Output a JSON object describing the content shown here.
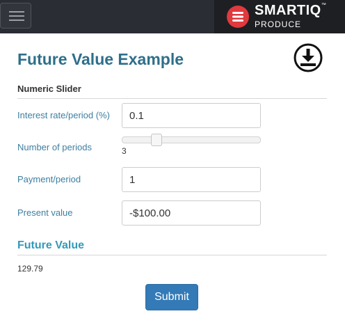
{
  "header": {
    "menu_icon": "hamburger-icon",
    "brand": {
      "name": "SMART",
      "name_accent": "IQ",
      "trademark": "™",
      "subtitle": "PRODUCE",
      "logo_icon": "smartiq-logo-icon",
      "logo_color": "#e0393e"
    }
  },
  "page": {
    "title": "Future Value Example",
    "download_icon": "download-icon",
    "section_label": "Numeric Slider"
  },
  "fields": {
    "interest_rate": {
      "label": "Interest rate/period (%)",
      "value": "0.1"
    },
    "periods": {
      "label": "Number of periods",
      "value": "3",
      "slider_fraction": 0.23
    },
    "payment": {
      "label": "Payment/period",
      "value": "1"
    },
    "present_value": {
      "label": "Present value",
      "value": "-$100.00"
    }
  },
  "result": {
    "title": "Future Value",
    "value": "129.79"
  },
  "actions": {
    "submit_label": "Submit"
  },
  "colors": {
    "title": "#2e6f8a",
    "label": "#3d7fa0",
    "result_title": "#3399bb",
    "button": "#337ab7",
    "topbar": "#2a2d33"
  }
}
